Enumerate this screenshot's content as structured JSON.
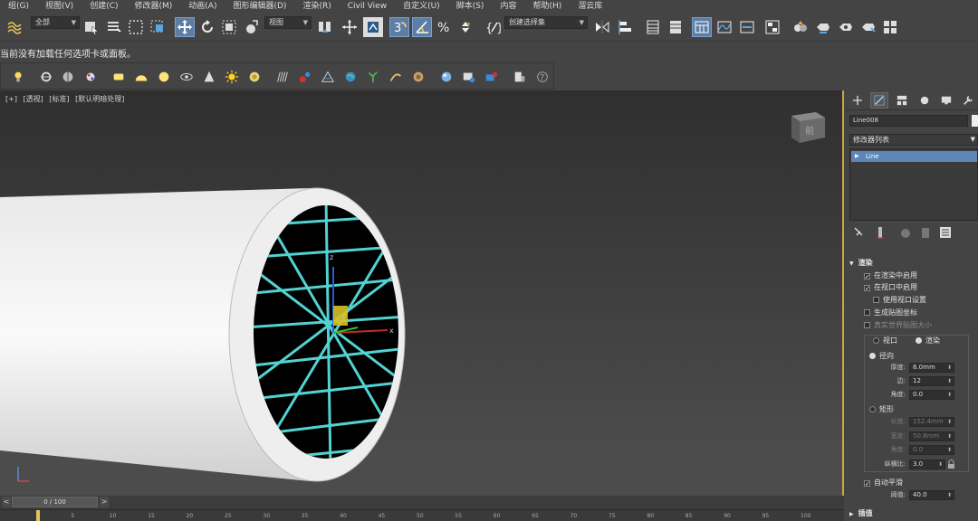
{
  "menu": [
    "组(G)",
    "视图(V)",
    "创建(C)",
    "修改器(M)",
    "动画(A)",
    "图形编辑器(D)",
    "渲染(R)",
    "Civil View",
    "自定义(U)",
    "脚本(S)",
    "内容",
    "帮助(H)",
    "溜云库"
  ],
  "toolbar": {
    "selection_filter": "全部",
    "ref_coord": "视图",
    "named_selection": "创建选择集"
  },
  "message": "当前没有加载任何选项卡或面板。",
  "viewport": {
    "labels": [
      "[+]",
      "[透视]",
      "[标准]",
      "[默认明暗处理]"
    ],
    "viewcube_label": "前",
    "axis_x": "x",
    "axis_z": "z"
  },
  "colors": {
    "cyan_spline": "#53d2d2",
    "selection_blue": "#5d87b8",
    "viewport_border": "#c9a646"
  },
  "command_panel": {
    "object_name": "Line008",
    "modifier_list": "修改器列表",
    "stack_items": [
      "Line"
    ],
    "rendering": {
      "header": "渲染",
      "enable_in_renderer": "在渲染中启用",
      "enable_in_viewport": "在视口中启用",
      "use_viewport_settings": "使用视口设置",
      "gen_mapping": "生成贴图坐标",
      "real_world_map": "真实世界贴图大小",
      "viewport_option": "视口",
      "render_option": "渲染",
      "radial": "径向",
      "thickness_label": "厚度:",
      "thickness_value": "6.0mm",
      "sides_label": "边:",
      "sides_value": "12",
      "angle_label": "角度:",
      "angle_value": "0.0",
      "rectangular": "矩形",
      "length_label": "长度:",
      "length_value": "152.4mm",
      "width_label": "宽度:",
      "width_value": "50.8mm",
      "angle2_label": "角度:",
      "angle2_value": "0.0",
      "aspect_label": "纵横比:",
      "aspect_value": "3.0",
      "auto_smooth": "自动平滑",
      "threshold_label": "阈值:",
      "threshold_value": "40.0"
    },
    "interpolation_header": "插值"
  },
  "timeline": {
    "frame": "0 / 100",
    "prev": "<",
    "next": ">",
    "ticks": [
      "5",
      "10",
      "15",
      "20",
      "25",
      "30",
      "35",
      "40",
      "45",
      "50",
      "55",
      "60",
      "65",
      "70",
      "75",
      "80",
      "85",
      "90",
      "95",
      "100"
    ]
  }
}
